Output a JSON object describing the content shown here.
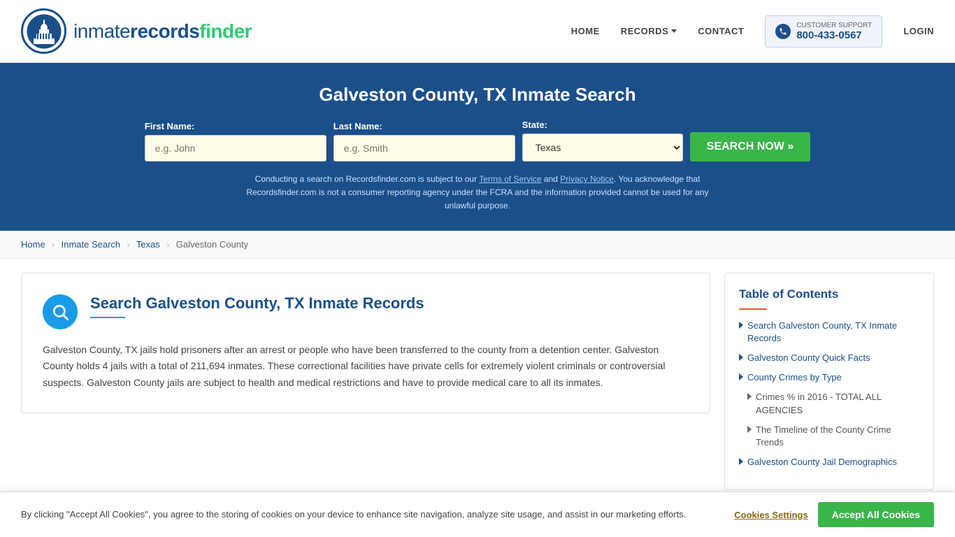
{
  "header": {
    "logo_text_part1": "inmaterecords",
    "logo_text_part2": "finder",
    "nav": {
      "home": "HOME",
      "records": "RECORDS",
      "contact": "CONTACT",
      "support_label": "CUSTOMER SUPPORT",
      "support_phone": "800-433-0567",
      "login": "LOGIN"
    }
  },
  "hero": {
    "title": "Galveston County, TX Inmate Search",
    "form": {
      "first_name_label": "First Name:",
      "first_name_placeholder": "e.g. John",
      "last_name_label": "Last Name:",
      "last_name_placeholder": "e.g. Smith",
      "state_label": "State:",
      "state_value": "Texas",
      "search_button": "SEARCH NOW »"
    },
    "disclaimer": "Conducting a search on Recordsfinder.com is subject to our Terms of Service and Privacy Notice. You acknowledge that Recordsfinder.com is not a consumer reporting agency under the FCRA and the information provided cannot be used for any unlawful purpose."
  },
  "breadcrumb": {
    "home": "Home",
    "inmate_search": "Inmate Search",
    "state": "Texas",
    "county": "Galveston County"
  },
  "article": {
    "heading": "Search Galveston County, TX Inmate Records",
    "body": "Galveston County, TX jails hold prisoners after an arrest or people who have been transferred to the county from a detention center. Galveston County holds 4 jails with a total of 211,694 inmates. These correctional facilities have private cells for extremely violent criminals or controversial suspects. Galveston County jails are subject to health and medical restrictions and have to provide medical care to all its inmates."
  },
  "toc": {
    "heading": "Table of Contents",
    "items": [
      {
        "label": "Search Galveston County, TX Inmate Records",
        "sub": false
      },
      {
        "label": "Galveston County Quick Facts",
        "sub": false
      },
      {
        "label": "County Crimes by Type",
        "sub": false
      },
      {
        "label": "Crimes % in 2016 - TOTAL ALL AGENCIES",
        "sub": true
      },
      {
        "label": "The Timeline of the County Crime Trends",
        "sub": true
      },
      {
        "label": "Galveston County Jail Demographics",
        "sub": false
      }
    ]
  },
  "cookie_banner": {
    "text": "By clicking \"Accept All Cookies\", you agree to the storing of cookies on your device to enhance site navigation, analyze site usage, and assist in our marketing efforts.",
    "settings_btn": "Cookies Settings",
    "accept_btn": "Accept All Cookies"
  }
}
